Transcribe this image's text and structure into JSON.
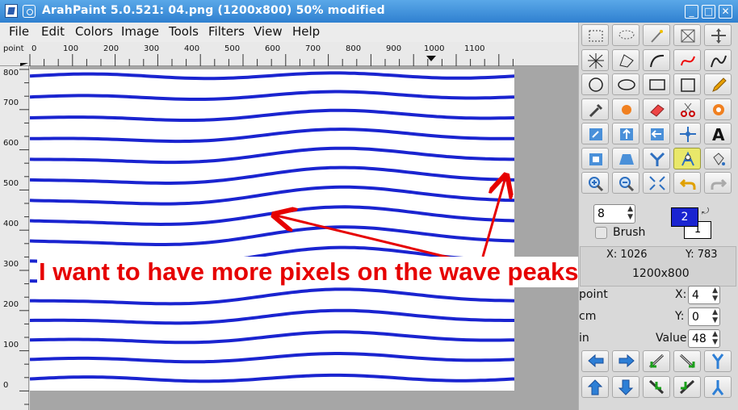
{
  "window": {
    "title": "ArahPaint 5.0.521: 04.png  (1200x800) 50% modified",
    "buttons": [
      "_",
      "□",
      "✕"
    ]
  },
  "menu": [
    "File",
    "Edit",
    "Colors",
    "Image",
    "Tools",
    "Filters",
    "View",
    "Help"
  ],
  "ruler": {
    "unit": "point",
    "top_labels": [
      "0",
      "100",
      "200",
      "300",
      "400",
      "500",
      "600",
      "700",
      "800",
      "900",
      "1000",
      "1100"
    ],
    "left_labels": [
      "800",
      "700",
      "600",
      "500",
      "400",
      "300",
      "200",
      "100",
      "0"
    ]
  },
  "annotation": {
    "text": "I want to have more pixels on the wave peaks",
    "color": "#e60000"
  },
  "canvas": {
    "line_color": "#1a24d0",
    "background": "#ffffff"
  },
  "panel": {
    "brush_size": "8",
    "brush_label": "Brush",
    "foreground_color_index": "2",
    "background_color_index": "1",
    "foreground_color": "#1a24d0",
    "coord_x": "X: 1026",
    "coord_y": "Y: 783",
    "image_size": "1200x800",
    "unit_point": "point",
    "unit_cm": "cm",
    "unit_in": "in",
    "x_label": "X:",
    "x_value": "4",
    "y_label": "Y:",
    "y_value": "0",
    "value_label": "Value",
    "value_value": "48"
  },
  "tools": [
    "rect-select-icon",
    "lasso-icon",
    "magic-wand-icon",
    "crop-icon",
    "move-icon",
    "star-line-icon",
    "polygon-select-icon",
    "curve-icon",
    "bezier-icon",
    "spline-icon",
    "circle-icon",
    "ellipse-icon",
    "rectangle-icon",
    "rounded-rect-icon",
    "pencil-icon",
    "eyedropper-icon",
    "fill-icon",
    "eraser-icon",
    "scissors-icon",
    "color-replace-icon",
    "rotate-icon",
    "flip-vertical-icon",
    "flip-horizontal-icon",
    "center-icon",
    "text-icon",
    "transform-icon",
    "perspective-icon",
    "symmetry-icon",
    "warp-icon",
    "bucket-icon",
    "zoom-in-icon",
    "zoom-out-icon",
    "fit-icon",
    "undo-icon",
    "redo-icon"
  ]
}
